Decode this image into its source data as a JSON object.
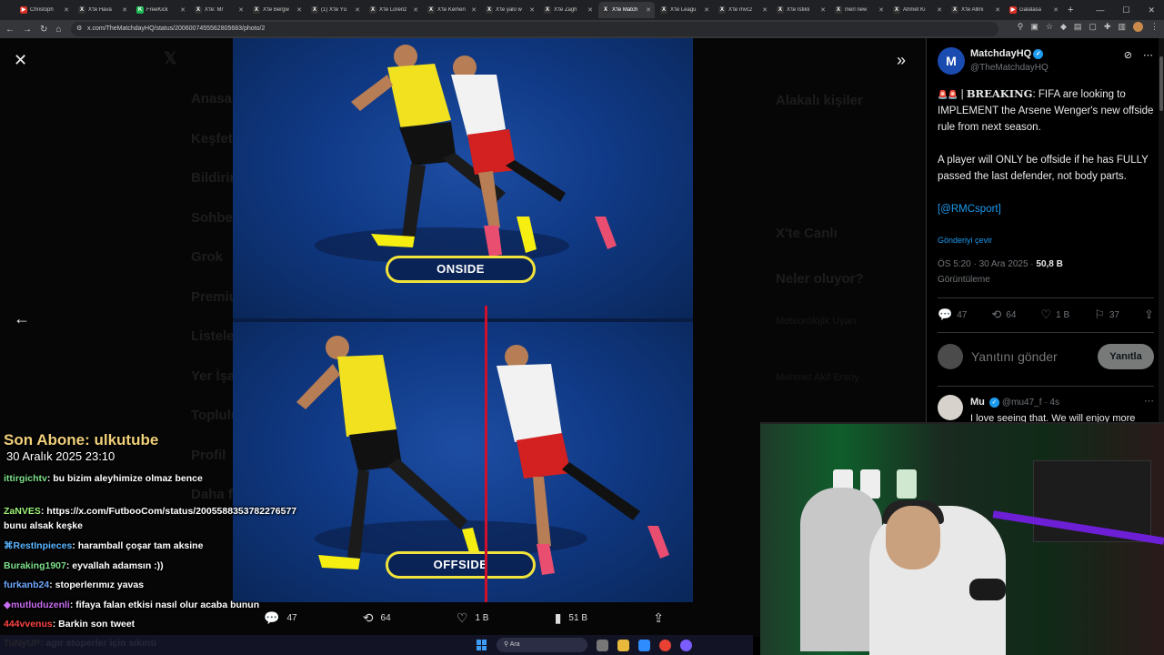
{
  "browser": {
    "tabs": [
      {
        "title": "Christoph",
        "color": "#d93025",
        "glyph": "▶"
      },
      {
        "title": "X'te Hava",
        "color": "#333333",
        "glyph": "X"
      },
      {
        "title": "FreeKick",
        "color": "#1db954",
        "glyph": "K"
      },
      {
        "title": "X'te: Mr",
        "color": "#333333",
        "glyph": "X"
      },
      {
        "title": "X'te Bergw",
        "color": "#333333",
        "glyph": "X"
      },
      {
        "title": "(1) X'te Yü",
        "color": "#333333",
        "glyph": "X"
      },
      {
        "title": "X'te Lorenz",
        "color": "#333333",
        "glyph": "X"
      },
      {
        "title": "X'te Kemen",
        "color": "#333333",
        "glyph": "X"
      },
      {
        "title": "X'te yalo w",
        "color": "#333333",
        "glyph": "X"
      },
      {
        "title": "X'te Zagh",
        "color": "#333333",
        "glyph": "X"
      },
      {
        "title": "X'te Match",
        "color": "#333333",
        "glyph": "X",
        "active": true
      },
      {
        "title": "X'te Leagu",
        "color": "#333333",
        "glyph": "X"
      },
      {
        "title": "X'te mvc2",
        "color": "#333333",
        "glyph": "X"
      },
      {
        "title": "X'te İstiklı",
        "color": "#333333",
        "glyph": "X"
      },
      {
        "title": "merl new",
        "color": "#333333",
        "glyph": "X"
      },
      {
        "title": "Ahmet Kı",
        "color": "#333333",
        "glyph": "X"
      },
      {
        "title": "X'te Allmi",
        "color": "#333333",
        "glyph": "X"
      },
      {
        "title": "Galatasa",
        "color": "#d93025",
        "glyph": "▶"
      }
    ],
    "url": "x.com/TheMatchdayHQ/status/2006007455562805683/photo/2"
  },
  "background_nav": {
    "items": [
      "Anasayfa",
      "Keşfet",
      "Bildirimler",
      "Sohbet",
      "Grok",
      "Premium",
      "Listeler",
      "Yer İşaretleri",
      "Topluluklar",
      "Profil",
      "Daha fazla"
    ],
    "sidebar_headings": [
      "Alakalı kişiler",
      "X'te Canlı",
      "Neler oluyor?"
    ],
    "trend_1": "Meteorolojik Uyarı",
    "trend_2": "Mehmet Akif Ersoy"
  },
  "photo": {
    "label_top": "ONSIDE",
    "label_bottom": "OFFSIDE"
  },
  "viewer_actions": {
    "replies": "47",
    "reposts": "64",
    "likes": "1 B",
    "views": "51 B"
  },
  "tweet": {
    "display_name": "MatchdayHQ",
    "handle": "@TheMatchdayHQ",
    "avatar_letter": "M",
    "siren": "🚨🚨",
    "sep": " | ",
    "breaking": "BREAKING",
    "line1_rest": ": FIFA are looking to IMPLEMENT the Arsene Wenger's new offside rule from next season.",
    "para2": "A player will ONLY be offside if he has FULLY passed the last defender, not body parts.",
    "link": "[@RMCsport]",
    "translate": "Gönderiyi çevir",
    "time": "ÖS 5:20 · 30 Ara 2025 · ",
    "views_count": "50,8 B",
    "views_label": "Görüntüleme",
    "stats": {
      "replies": "47",
      "reposts": "64",
      "likes": "1 B",
      "bookmarks": "37"
    },
    "reply_placeholder": "Yanıtını gönder",
    "reply_button": "Yanıtla"
  },
  "reply": {
    "name": "Mu",
    "handle": "@mu47_f · 4s",
    "text": "I love seeing that. We will enjoy more"
  },
  "chat": {
    "sub_title": "Son Abone: ulkutube",
    "sub_date": "30 Aralık 2025   23:10",
    "messages": [
      {
        "user": "ittirgichtv",
        "color": "#7ee08a",
        "text": "bu bizim aleyhimize olmaz bence"
      },
      {
        "user": "ZaNVES",
        "color": "#9ff57a",
        "text": "https://x.com/FutbooCom/status/2005588353782276577 bunu alsak keşke"
      },
      {
        "user": "RestInpieces",
        "color": "#5ab4ff",
        "text": "haramball çoşar tam aksine",
        "badge": "⌘"
      },
      {
        "user": "Buraking1907",
        "color": "#7ee08a",
        "text": "eyvallah adamsın :))"
      },
      {
        "user": "furkanb24",
        "color": "#6fa8ff",
        "text": "stoperlerımız yavas"
      },
      {
        "user": "mutluduzenli",
        "color": "#c86cf0",
        "text": "fifaya falan etkisi nasıl olur acaba bunun",
        "badge": "◆"
      },
      {
        "user": "444vvenus",
        "color": "#ff4444",
        "text": "Barkin son tweet"
      },
      {
        "user": "TuNyUP",
        "color": "#e0c04c",
        "text": "agır stoperler için sıkıntı"
      }
    ]
  },
  "taskbar": {
    "search": "Ara"
  }
}
